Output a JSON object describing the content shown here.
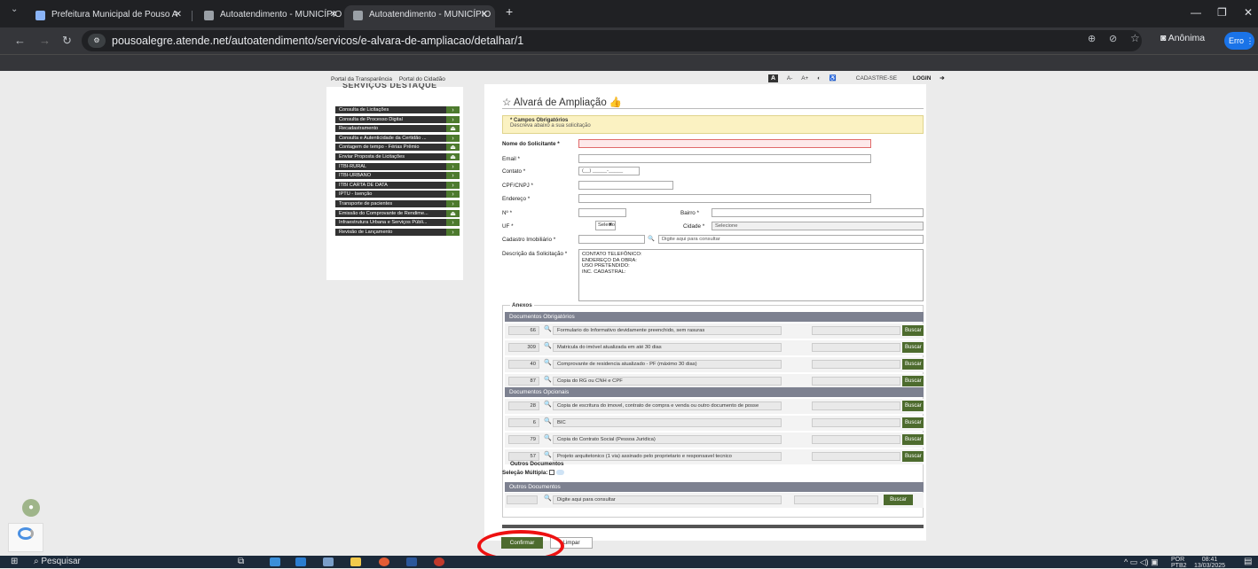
{
  "browser": {
    "tabs": [
      {
        "title": "Prefeitura Municipal de Pouso A",
        "active": false
      },
      {
        "title": "Autoatendimento - MUNICÍPIO",
        "active": false
      },
      {
        "title": "Autoatendimento - MUNICÍPIO",
        "active": true
      }
    ],
    "new_tab": "+",
    "url": "pousoalegre.atende.net/autoatendimento/servicos/e-alvara-de-ampliacao/detalhar/1",
    "profile_label": "Anônima",
    "error_badge": "Erro"
  },
  "site": {
    "top_links": [
      "Portal da Transparência",
      "Portal do Cidadão"
    ],
    "accessibility": [
      "A",
      "A-",
      "A+"
    ],
    "cadastre_label": "CADASTRE-SE",
    "login_label": "LOGIN",
    "accent_color": "#4d6b2e"
  },
  "sidebar": {
    "title": "SERVIÇOS DESTAQUE",
    "items": [
      {
        "label": "Consulta de Licitações",
        "icon": "chevron-right"
      },
      {
        "label": "Consulta de Processo Digital",
        "icon": "chevron-right"
      },
      {
        "label": "Recadastramento",
        "icon": "lock"
      },
      {
        "label": "Consulta e Autenticidade da Certidão ...",
        "icon": "chevron-right"
      },
      {
        "label": "Contagem de tempo - Férias Prêmio",
        "icon": "lock"
      },
      {
        "label": "Enviar Proposta de Licitações",
        "icon": "lock"
      },
      {
        "label": "ITBI-RURAL",
        "icon": "chevron-right"
      },
      {
        "label": "ITBI-URBANO",
        "icon": "chevron-right"
      },
      {
        "label": "ITBI CARTA DE DATA",
        "icon": "chevron-right"
      },
      {
        "label": "IPTU - Isenção",
        "icon": "chevron-right"
      },
      {
        "label": "Transporte de pacientes",
        "icon": "chevron-right"
      },
      {
        "label": "Emissão do Comprovante de Rendime...",
        "icon": "lock"
      },
      {
        "label": "Infraestrutura Urbana e Serviços Públi...",
        "icon": "chevron-right"
      },
      {
        "label": "Revisão de Lançamento",
        "icon": "chevron-right"
      }
    ]
  },
  "form": {
    "title": "Alvará de Ampliação",
    "notice_title": "* Campos Obrigatórios",
    "notice_text": "Descreva abaixo a sua solicitação",
    "labels": {
      "nome": "Nome do Solicitante *",
      "email": "Email *",
      "contato": "Contato *",
      "cpf": "CPF/CNPJ *",
      "endereco": "Endereço *",
      "numero": "Nº *",
      "bairro": "Bairro *",
      "uf": "UF *",
      "cidade": "Cidade *",
      "cadastro": "Cadastro Imobiliário *",
      "descricao": "Descrição da Solicitação *"
    },
    "contato_placeholder": "(__) _____-_____",
    "uf_value": "Selecio",
    "cidade_value": "Selecione",
    "cadastro_placeholder": "Digite aqui para consultar",
    "descricao_lines": [
      "CONTATO TELEFÔNICO:",
      "ENDEREÇO DA OBRA:",
      "USO PRETENDIDO:",
      "INC. CADASTRAL:"
    ]
  },
  "anexos": {
    "title": "Anexos",
    "obrigatorios_title": "Documentos Obrigatórios",
    "obrigatorios": [
      {
        "num": "66",
        "desc": "Formulario do Informativo devidamente preenchido, sem rasuras"
      },
      {
        "num": "309",
        "desc": "Matricula do imóvel atualizada em até 30 dias"
      },
      {
        "num": "40",
        "desc": "Comprovante de residencia atualizado - PF (máximo 30 dias)"
      },
      {
        "num": "87",
        "desc": "Copia do RG ou CNH e CPF"
      }
    ],
    "opcionais_title": "Documentos Opcionais",
    "opcionais": [
      {
        "num": "28",
        "desc": "Copia de escritura do imovel, contrato de compra e venda ou outro documento de posse"
      },
      {
        "num": "6",
        "desc": "BIC"
      },
      {
        "num": "79",
        "desc": "Copia do Contrato Social (Pessoa Juridica)"
      },
      {
        "num": "57",
        "desc": "Projeto arquitetonico (1 via) assinado pelo proprietario e responsavel tecnico"
      }
    ],
    "row_button": "Buscar",
    "outros_label": "Outros Documentos",
    "selecao_label": "Seleção Múltipla",
    "outros_head": "Outros Documentos",
    "outros_placeholder": "Digite aqui para consultar",
    "buscar_label": "Buscar"
  },
  "actions": {
    "confirm": "Confirmar",
    "clear": "Limpar"
  },
  "taskbar": {
    "search": "Pesquisar",
    "lang": "POR",
    "lang2": "PTB2",
    "time": "08:41",
    "date": "13/03/2025"
  }
}
